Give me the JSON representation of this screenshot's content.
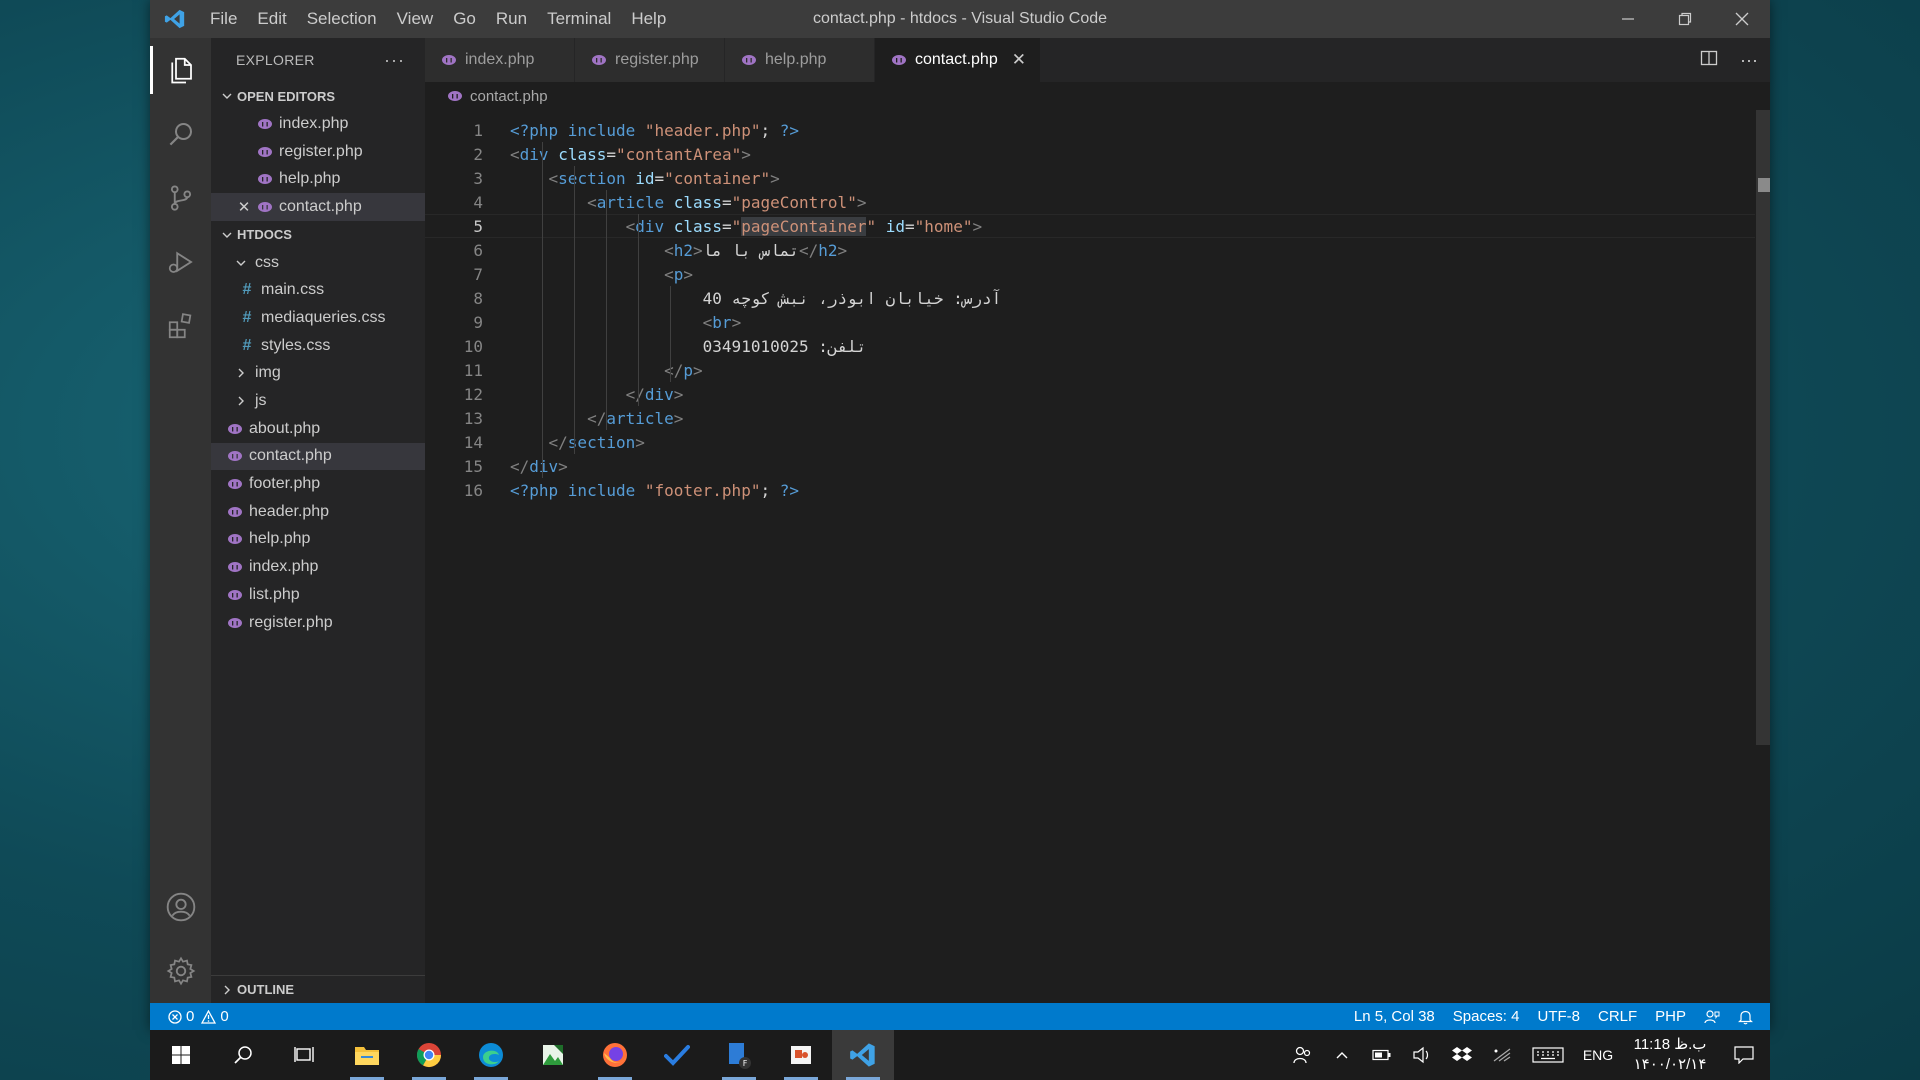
{
  "window": {
    "title": "contact.php - htdocs - Visual Studio Code",
    "menu": [
      "File",
      "Edit",
      "Selection",
      "View",
      "Go",
      "Run",
      "Terminal",
      "Help"
    ]
  },
  "sidebar": {
    "title": "EXPLORER",
    "open_editors_label": "OPEN EDITORS",
    "open_editors": [
      "index.php",
      "register.php",
      "help.php",
      "contact.php"
    ],
    "folder_label": "HTDOCS",
    "css_folder": "css",
    "css_files": [
      "main.css",
      "mediaqueries.css",
      "styles.css"
    ],
    "img_folder": "img",
    "js_folder": "js",
    "files": [
      "about.php",
      "contact.php",
      "footer.php",
      "header.php",
      "help.php",
      "index.php",
      "list.php",
      "register.php"
    ],
    "outline_label": "OUTLINE"
  },
  "tabs": [
    "index.php",
    "register.php",
    "help.php",
    "contact.php"
  ],
  "breadcrumb": "contact.php",
  "code_lines": [
    {
      "n": "1",
      "s": [
        [
          "php",
          "<?php include "
        ],
        [
          "str",
          "\"header.php\""
        ],
        [
          "txt",
          "; "
        ],
        [
          "php",
          "?>"
        ]
      ]
    },
    {
      "n": "2",
      "s": [
        [
          "br",
          "<"
        ],
        [
          "tag",
          "div"
        ],
        [
          "txt",
          " "
        ],
        [
          "attr",
          "class"
        ],
        [
          "txt",
          "="
        ],
        [
          "str",
          "\"contantArea\""
        ],
        [
          "br",
          ">"
        ]
      ]
    },
    {
      "n": "3",
      "s": [
        [
          "txt",
          "    "
        ],
        [
          "br",
          "<"
        ],
        [
          "tag",
          "section"
        ],
        [
          "txt",
          " "
        ],
        [
          "attr",
          "id"
        ],
        [
          "txt",
          "="
        ],
        [
          "str",
          "\"container\""
        ],
        [
          "br",
          ">"
        ]
      ]
    },
    {
      "n": "4",
      "s": [
        [
          "txt",
          "        "
        ],
        [
          "br",
          "<"
        ],
        [
          "tag",
          "article"
        ],
        [
          "txt",
          " "
        ],
        [
          "attr",
          "class"
        ],
        [
          "txt",
          "="
        ],
        [
          "str",
          "\"pageControl\""
        ],
        [
          "br",
          ">"
        ]
      ]
    },
    {
      "n": "5",
      "s": [
        [
          "txt",
          "            "
        ],
        [
          "br",
          "<"
        ],
        [
          "tag",
          "div"
        ],
        [
          "txt",
          " "
        ],
        [
          "attr",
          "class"
        ],
        [
          "txt",
          "="
        ],
        [
          "str",
          "\""
        ],
        [
          "strhl",
          "pageContainer"
        ],
        [
          "str",
          "\""
        ],
        [
          "txt",
          " "
        ],
        [
          "attr",
          "id"
        ],
        [
          "txt",
          "="
        ],
        [
          "str",
          "\"home\""
        ],
        [
          "br",
          ">"
        ]
      ]
    },
    {
      "n": "6",
      "s": [
        [
          "txt",
          "                "
        ],
        [
          "br",
          "<"
        ],
        [
          "tag",
          "h2"
        ],
        [
          "br",
          ">"
        ],
        [
          "txt",
          "تماس با ما"
        ],
        [
          "br",
          "</"
        ],
        [
          "tag",
          "h2"
        ],
        [
          "br",
          ">"
        ]
      ]
    },
    {
      "n": "7",
      "s": [
        [
          "txt",
          "                "
        ],
        [
          "br",
          "<"
        ],
        [
          "tag",
          "p"
        ],
        [
          "br",
          ">"
        ]
      ]
    },
    {
      "n": "8",
      "s": [
        [
          "txt",
          "                    آدرس: خیابان ابوذر، نبش کوچه 40"
        ]
      ]
    },
    {
      "n": "9",
      "s": [
        [
          "txt",
          "                    "
        ],
        [
          "br",
          "<"
        ],
        [
          "tag",
          "br"
        ],
        [
          "br",
          ">"
        ]
      ]
    },
    {
      "n": "10",
      "s": [
        [
          "txt",
          "                    تلفن: 03491010025"
        ]
      ]
    },
    {
      "n": "11",
      "s": [
        [
          "txt",
          "                "
        ],
        [
          "br",
          "</"
        ],
        [
          "tag",
          "p"
        ],
        [
          "br",
          ">"
        ]
      ]
    },
    {
      "n": "12",
      "s": [
        [
          "txt",
          "            "
        ],
        [
          "br",
          "</"
        ],
        [
          "tag",
          "div"
        ],
        [
          "br",
          ">"
        ]
      ]
    },
    {
      "n": "13",
      "s": [
        [
          "txt",
          "        "
        ],
        [
          "br",
          "</"
        ],
        [
          "tag",
          "article"
        ],
        [
          "br",
          ">"
        ]
      ]
    },
    {
      "n": "14",
      "s": [
        [
          "txt",
          "    "
        ],
        [
          "br",
          "</"
        ],
        [
          "tag",
          "section"
        ],
        [
          "br",
          ">"
        ]
      ]
    },
    {
      "n": "15",
      "s": [
        [
          "br",
          "</"
        ],
        [
          "tag",
          "div"
        ],
        [
          "br",
          ">"
        ]
      ]
    },
    {
      "n": "16",
      "s": [
        [
          "php",
          "<?php include "
        ],
        [
          "str",
          "\"footer.php\""
        ],
        [
          "txt",
          "; "
        ],
        [
          "php",
          "?>"
        ]
      ]
    }
  ],
  "current_line": "5",
  "status": {
    "errors": "0",
    "warnings": "0",
    "position": "Ln 5, Col 38",
    "spaces": "Spaces: 4",
    "encoding": "UTF-8",
    "eol": "CRLF",
    "language": "PHP"
  },
  "taskbar": {
    "language": "ENG",
    "time": "11:18 ب.ظ",
    "date": "۱۴۰۰/۰۲/۱۴"
  },
  "colors": {
    "accent": "#007acc",
    "php_icon": "#a074c4",
    "css_icon": "#519aba"
  }
}
